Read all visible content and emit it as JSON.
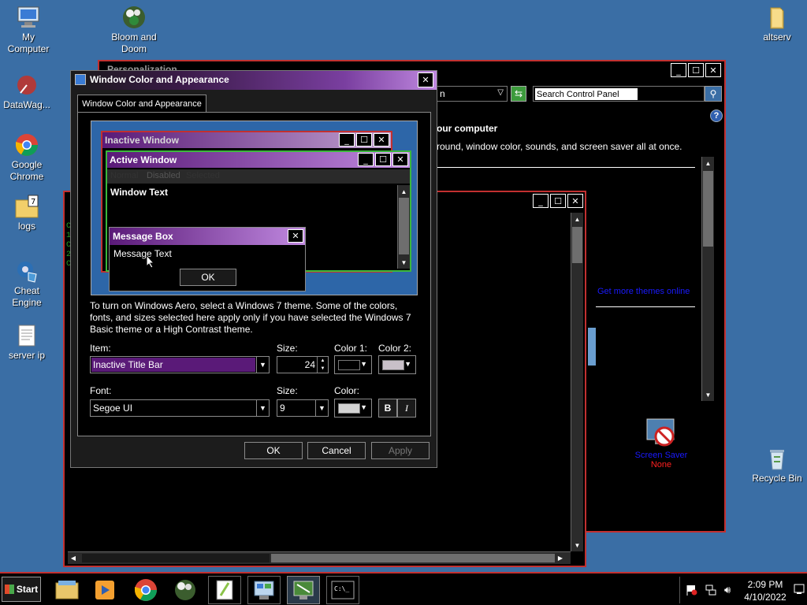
{
  "desktop": {
    "icons": [
      {
        "label": "My Computer",
        "icon": "computer-icon"
      },
      {
        "label": "Bloom and Doom",
        "icon": "flower-game-icon"
      },
      {
        "label": "altserv",
        "icon": "folder-icon"
      },
      {
        "label": "DataWag...",
        "icon": "datawag-icon"
      },
      {
        "label": "Google Chrome",
        "icon": "chrome-icon"
      },
      {
        "label": "logs",
        "icon": "folder-icon"
      },
      {
        "label": "Cheat Engine",
        "icon": "cheat-engine-icon"
      },
      {
        "label": "server ip",
        "icon": "text-file-icon"
      },
      {
        "label": "Recycle Bin",
        "icon": "recycle-bin-icon"
      }
    ]
  },
  "personalization": {
    "title": "Personalization",
    "search_placeholder": "Search Control Panel",
    "address_fragment": "n",
    "heading_fragment": "our computer",
    "subtext_fragment": "round, window color, sounds, and screen saver all at once.",
    "link_more_themes": "Get more themes online",
    "screen_saver_label": "Screen Saver",
    "screen_saver_value": "None"
  },
  "dialog": {
    "title": "Window Color and Appearance",
    "tab": "Window Color and Appearance",
    "preview": {
      "inactive_title": "Inactive Window",
      "active_title": "Active Window",
      "menu": [
        "Normal",
        "Disabled",
        "Selected"
      ],
      "window_text": "Window Text",
      "msgbox_title": "Message Box",
      "msgbox_text": "Message Text",
      "msgbox_ok": "OK"
    },
    "info": "To turn on Windows Aero, select a Windows 7 theme.  Some of the colors, fonts, and sizes selected here apply only if you have selected the Windows 7 Basic theme or a High Contrast theme.",
    "labels": {
      "item": "Item:",
      "size": "Size:",
      "color1": "Color 1:",
      "color2": "Color 2:",
      "font": "Font:",
      "font_size": "Size:",
      "color": "Color:"
    },
    "item_value": "Inactive Title Bar",
    "item_size": "24",
    "font_value": "Segoe UI",
    "font_size_value": "9",
    "bold": "B",
    "italic": "I",
    "buttons": {
      "ok": "OK",
      "cancel": "Cancel",
      "apply": "Apply"
    },
    "colors": {
      "color1": "#000000",
      "color2": "#c8c0c8",
      "font_color": "#d4d4d4",
      "title_active": "#7a3fa0",
      "item_highlight": "#5a1a78"
    }
  },
  "taskbar": {
    "start": "Start",
    "time": "2:09 PM",
    "date": "4/10/2022",
    "items": [
      "explorer-icon",
      "media-player-icon",
      "chrome-icon",
      "bloom-doom-icon",
      "notepadpp-icon",
      "control-panel-icon",
      "personalization-icon",
      "cmd-icon"
    ]
  }
}
